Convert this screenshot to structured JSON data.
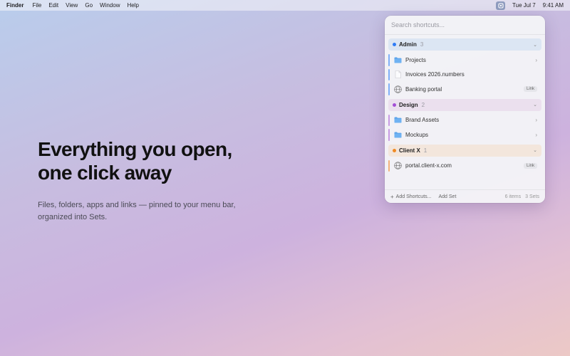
{
  "menubar": {
    "app_name": "Finder",
    "menus": [
      "File",
      "Edit",
      "View",
      "Go",
      "Window",
      "Help"
    ],
    "tray_icon": "shortcuts-app-icon",
    "date": "Tue Jul 7",
    "time": "9:41 AM"
  },
  "hero": {
    "title_line1": "Everything you open,",
    "title_line2": "one click away",
    "subtitle_line1": "Files, folders, apps and links — pinned to your menu bar,",
    "subtitle_line2": "organized into Sets."
  },
  "popover": {
    "search_placeholder": "Search shortcuts...",
    "sets": [
      {
        "name": "Admin",
        "count": "3",
        "color": "#2f7cf6",
        "bg": "#dce6f3",
        "items": [
          {
            "label": "Projects",
            "icon": "folder-icon",
            "accessory": "›",
            "badge": ""
          },
          {
            "label": "Invoices 2026.numbers",
            "icon": "document-icon",
            "accessory": "",
            "badge": ""
          },
          {
            "label": "Banking portal",
            "icon": "globe-icon",
            "accessory": "",
            "badge": "Link"
          }
        ]
      },
      {
        "name": "Design",
        "count": "2",
        "color": "#a44fd6",
        "bg": "#ebe0ee",
        "items": [
          {
            "label": "Brand Assets",
            "icon": "folder-icon",
            "accessory": "›",
            "badge": ""
          },
          {
            "label": "Mockups",
            "icon": "folder-icon",
            "accessory": "›",
            "badge": ""
          }
        ]
      },
      {
        "name": "Client X",
        "count": "1",
        "color": "#f08a24",
        "bg": "#f3e6dc",
        "items": [
          {
            "label": "portal.client-x.com",
            "icon": "globe-icon",
            "accessory": "",
            "badge": "Link"
          }
        ]
      }
    ],
    "footer": {
      "add_shortcuts": "Add Shortcuts...",
      "add_set": "Add Set",
      "items_count": "6 items",
      "sets_count": "3 Sets"
    }
  }
}
